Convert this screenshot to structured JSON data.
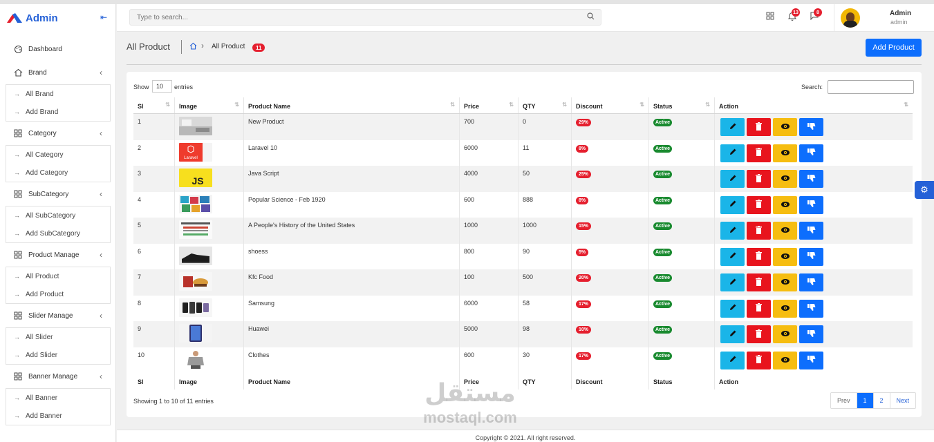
{
  "app": {
    "title": "Admin",
    "collapse_icon": "collapse-left-icon"
  },
  "header": {
    "search_placeholder": "Type to search...",
    "notifications": [
      {
        "icon": "apps-grid-icon",
        "count": ""
      },
      {
        "icon": "bell-icon",
        "count": "13"
      },
      {
        "icon": "chat-icon",
        "count": "8"
      }
    ],
    "user": {
      "name": "Admin",
      "role": "admin"
    }
  },
  "sidebar": {
    "items": [
      {
        "label": "Dashboard",
        "icon": "palette-icon",
        "sub": []
      },
      {
        "label": "Brand",
        "icon": "home-icon",
        "sub": [
          "All Brand",
          "Add Brand"
        ]
      },
      {
        "label": "Category",
        "icon": "grid-icon",
        "sub": [
          "All Category",
          "Add Category"
        ]
      },
      {
        "label": "SubCategory",
        "icon": "grid-icon",
        "sub": [
          "All SubCategory",
          "Add SubCategory"
        ]
      },
      {
        "label": "Product Manage",
        "icon": "grid-icon",
        "sub": [
          "All Product",
          "Add Product"
        ]
      },
      {
        "label": "Slider Manage",
        "icon": "grid-icon",
        "sub": [
          "All Slider",
          "Add Slider"
        ]
      },
      {
        "label": "Banner Manage",
        "icon": "grid-icon",
        "sub": [
          "All Banner",
          "Add Banner"
        ]
      }
    ]
  },
  "page": {
    "title": "All Product",
    "breadcrumb_current": "All Product",
    "breadcrumb_badge": "11",
    "add_button": "Add Product"
  },
  "table": {
    "show_label": "Show",
    "entries_value": "10",
    "entries_label": "entries",
    "search_label": "Search:",
    "columns": [
      "Sl",
      "Image",
      "Product Name",
      "Price",
      "QTY",
      "Discount",
      "Status",
      "Action"
    ],
    "rows": [
      {
        "sl": "1",
        "image": "kitchen",
        "name": "New Product",
        "price": "700",
        "qty": "0",
        "discount": "29%",
        "status": "Active"
      },
      {
        "sl": "2",
        "image": "laravel",
        "name": "Laravel 10",
        "price": "6000",
        "qty": "11",
        "discount": "8%",
        "status": "Active"
      },
      {
        "sl": "3",
        "image": "js",
        "name": "Java Script",
        "price": "4000",
        "qty": "50",
        "discount": "25%",
        "status": "Active"
      },
      {
        "sl": "4",
        "image": "magazines",
        "name": "Popular Science - Feb 1920",
        "price": "600",
        "qty": "888",
        "discount": "8%",
        "status": "Active"
      },
      {
        "sl": "5",
        "image": "book",
        "name": "A People's History of the United States",
        "price": "1000",
        "qty": "1000",
        "discount": "15%",
        "status": "Active"
      },
      {
        "sl": "6",
        "image": "shoes",
        "name": "shoess",
        "price": "800",
        "qty": "90",
        "discount": "5%",
        "status": "Active"
      },
      {
        "sl": "7",
        "image": "food",
        "name": "Kfc Food",
        "price": "100",
        "qty": "500",
        "discount": "20%",
        "status": "Active"
      },
      {
        "sl": "8",
        "image": "phones",
        "name": "Samsung",
        "price": "6000",
        "qty": "58",
        "discount": "17%",
        "status": "Active"
      },
      {
        "sl": "9",
        "image": "phone",
        "name": "Huawei",
        "price": "5000",
        "qty": "98",
        "discount": "10%",
        "status": "Active"
      },
      {
        "sl": "10",
        "image": "shirt",
        "name": "Clothes",
        "price": "600",
        "qty": "30",
        "discount": "17%",
        "status": "Active"
      }
    ],
    "action_icons": [
      "edit-icon",
      "trash-icon",
      "eye-icon",
      "thumbs-down-icon"
    ],
    "info": "Showing 1 to 10 of 11 entries",
    "pagination": [
      "Prev",
      "1",
      "2",
      "Next"
    ],
    "active_page": "1"
  },
  "footer": {
    "text": "Copyright © 2021. All right reserved."
  },
  "watermark": {
    "arabic": "مستقل",
    "latin": "mostaql.com"
  },
  "colors": {
    "primary": "#0d6efd",
    "brand": "#2561d7",
    "danger": "#e51f2e",
    "success": "#198a2f",
    "info": "#1ab5e8",
    "warning": "#f6bd10"
  }
}
